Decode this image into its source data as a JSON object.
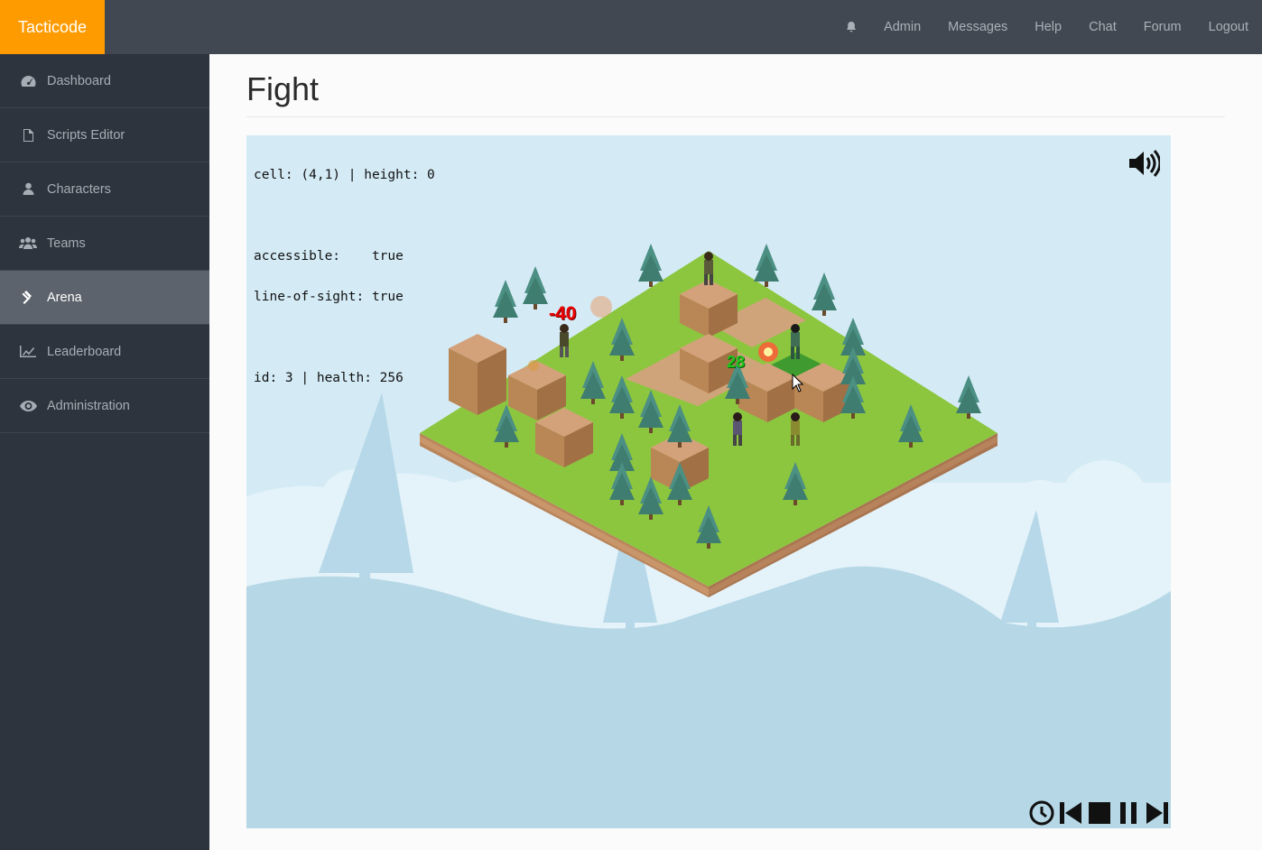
{
  "brand": {
    "name": "Tacticode"
  },
  "navbar": {
    "bell_icon": "bell-icon",
    "links": [
      "Admin",
      "Messages",
      "Help",
      "Chat",
      "Forum",
      "Logout"
    ]
  },
  "sidebar": {
    "items": [
      {
        "label": "Dashboard",
        "icon": "dashboard-icon",
        "active": false
      },
      {
        "label": "Scripts Editor",
        "icon": "file-icon",
        "active": false
      },
      {
        "label": "Characters",
        "icon": "user-icon",
        "active": false
      },
      {
        "label": "Teams",
        "icon": "users-icon",
        "active": false
      },
      {
        "label": "Arena",
        "icon": "gavel-icon",
        "active": true
      },
      {
        "label": "Leaderboard",
        "icon": "chart-icon",
        "active": false
      },
      {
        "label": "Administration",
        "icon": "eye-icon",
        "active": false
      }
    ]
  },
  "page": {
    "title": "Fight"
  },
  "arena": {
    "info": {
      "cell_line": "cell: (4,1) | height: 0",
      "accessible_line": "accessible:    true",
      "los_line": "line-of-sight: true",
      "id_line": "id: 3 | health: 256"
    },
    "damage_text": "-40",
    "heal_text": "28",
    "controls": [
      "clock-icon",
      "skip-back-icon",
      "stop-icon",
      "pause-icon",
      "skip-forward-icon"
    ],
    "sound_icon": "volume-icon"
  },
  "colors": {
    "brand": "#fe9b00",
    "navbar": "#414851",
    "sidebar": "#2e343d",
    "sidebar_active": "#5c636c",
    "sky": "#d4ebf6",
    "grass": "#8cc63f",
    "dirt": "#c9966b"
  }
}
